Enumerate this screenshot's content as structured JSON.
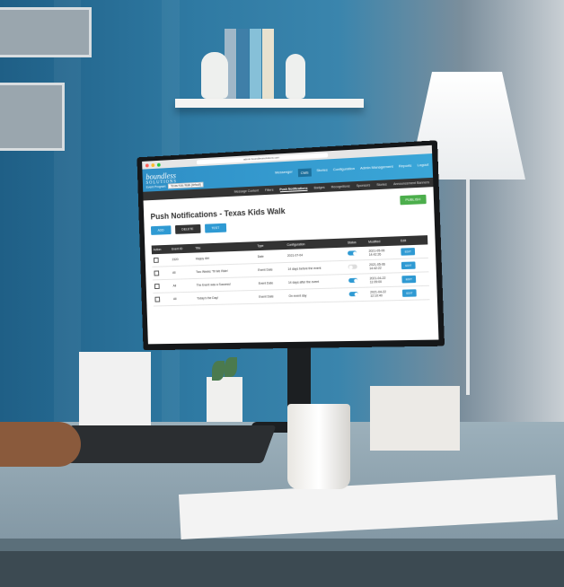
{
  "browser": {
    "url": "admin.boundlesssolutions.com"
  },
  "app": {
    "logo_line1": "boundless",
    "logo_line2": "SOLUTIONS",
    "event_program_label": "Event Program:",
    "event_program_value": "Texas Kids Walk (default)",
    "top_nav": [
      "Messenger",
      "CMS",
      "Stories",
      "Configuration",
      "Admin Management",
      "Reports",
      "Logout"
    ],
    "top_nav_active": "CMS",
    "sub_nav": [
      "Message Content",
      "Filters",
      "Push Notifications",
      "Badges",
      "Recognitions",
      "Sponsors",
      "Stories",
      "Announcement Banners"
    ],
    "sub_nav_active": "Push Notifications"
  },
  "page": {
    "title": "Push Notifications - Texas Kids Walk",
    "publish_label": "PUBLISH",
    "buttons": [
      {
        "label": "ADD",
        "color": "#2f9ad3"
      },
      {
        "label": "DELETE",
        "color": "#333333"
      },
      {
        "label": "TEST",
        "color": "#2f9ad3"
      }
    ],
    "tools": {
      "settings_icon": "gear-icon",
      "download_icon": "download-icon"
    }
  },
  "table": {
    "headers": [
      "Action",
      "Event ID",
      "Title",
      "Type",
      "Configuration",
      "Status",
      "Modified",
      "Edit"
    ],
    "rows": [
      {
        "event_id": "2320",
        "title": "Happy 4th!",
        "type": "Date",
        "configuration": "2021-07-04",
        "status": "on",
        "modified_date": "2021-05-06",
        "modified_time": "14:42:26",
        "edit": "EDIT"
      },
      {
        "event_id": "All",
        "title": "Two Weeks 'Til We Ride!",
        "type": "Event Date",
        "configuration": "14 days before the event",
        "status": "off",
        "modified_date": "2021-05-06",
        "modified_time": "14:42:22",
        "edit": "EDIT"
      },
      {
        "event_id": "All",
        "title": "The Event was a Success!",
        "type": "Event Date",
        "configuration": "14 days after the event",
        "status": "on",
        "modified_date": "2021-04-22",
        "modified_time": "11:09:00",
        "edit": "EDIT"
      },
      {
        "event_id": "All",
        "title": "Today's the Day!",
        "type": "Event Date",
        "configuration": "On event day",
        "status": "on",
        "modified_date": "2021-04-22",
        "modified_time": "12:10:40",
        "edit": "EDIT"
      }
    ]
  },
  "colors": {
    "header_blue": "#3aa6d8",
    "subnav_dark": "#333333",
    "publish_green": "#4cae4c",
    "accent_blue": "#2f9ad3"
  }
}
